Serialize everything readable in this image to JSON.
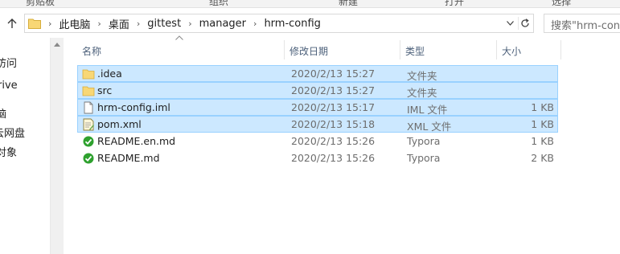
{
  "ribbon": {
    "labels": [
      "剪贴板",
      "组织",
      "新建",
      "打开",
      "选择"
    ]
  },
  "address": {
    "crumbs": [
      "此电脑",
      "桌面",
      "gittest",
      "manager",
      "hrm-config"
    ]
  },
  "search": {
    "placeholder": "搜索\"hrm-confi"
  },
  "nav": {
    "items": [
      "访问",
      "rive",
      "脑",
      "云网盘",
      "对象"
    ]
  },
  "columns": {
    "name": "名称",
    "date": "修改日期",
    "type": "类型",
    "size": "大小"
  },
  "files": [
    {
      "name": ".idea",
      "date": "2020/2/13 15:27",
      "type": "文件夹",
      "size": "",
      "icon": "folder-icon",
      "selected": true
    },
    {
      "name": "src",
      "date": "2020/2/13 15:27",
      "type": "文件夹",
      "size": "",
      "icon": "folder-icon",
      "selected": true
    },
    {
      "name": "hrm-config.iml",
      "date": "2020/2/13 15:17",
      "type": "IML 文件",
      "size": "1 KB",
      "icon": "document-icon",
      "selected": true
    },
    {
      "name": "pom.xml",
      "date": "2020/2/13 15:18",
      "type": "XML 文件",
      "size": "1 KB",
      "icon": "xml-file-icon",
      "selected": true
    },
    {
      "name": "README.en.md",
      "date": "2020/2/13 15:26",
      "type": "Typora",
      "size": "1 KB",
      "icon": "typora-check-icon",
      "selected": false
    },
    {
      "name": "README.md",
      "date": "2020/2/13 15:26",
      "type": "Typora",
      "size": "2 KB",
      "icon": "typora-check-icon",
      "selected": false
    }
  ],
  "colors": {
    "selection": "#cce8ff",
    "selection_border": "#99d1ff",
    "folder": "#f8d775",
    "typora_check": "#2ea12e"
  }
}
